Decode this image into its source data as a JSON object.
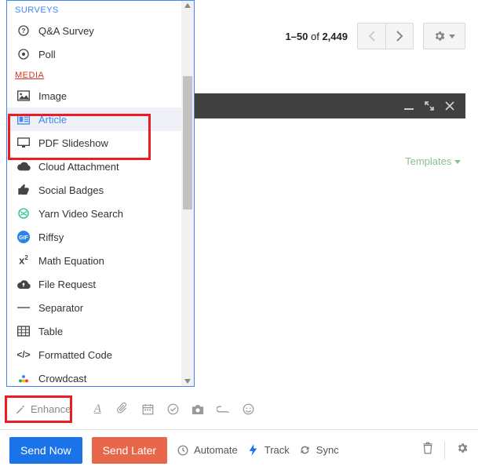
{
  "pager": {
    "range": "1–50",
    "of": " of ",
    "total": "2,449"
  },
  "templates_label": "Templates",
  "dropdown": {
    "surveys_header": "SURVEYS",
    "media_header": "MEDIA",
    "items": {
      "qa": "Q&A Survey",
      "poll": "Poll",
      "image": "Image",
      "article": "Article",
      "pdf": "PDF Slideshow",
      "cloud": "Cloud Attachment",
      "badges": "Social Badges",
      "yarn": "Yarn Video Search",
      "riffsy": "Riffsy",
      "math": "Math Equation",
      "filereq": "File Request",
      "separator": "Separator",
      "table": "Table",
      "code": "Formatted Code",
      "crowdcast": "Crowdcast"
    }
  },
  "compose": {
    "enhance": "Enhance",
    "format_A": "A"
  },
  "sendbar": {
    "send_now": "Send Now",
    "send_later": "Send Later",
    "automate": "Automate",
    "track": "Track",
    "sync": "Sync"
  }
}
